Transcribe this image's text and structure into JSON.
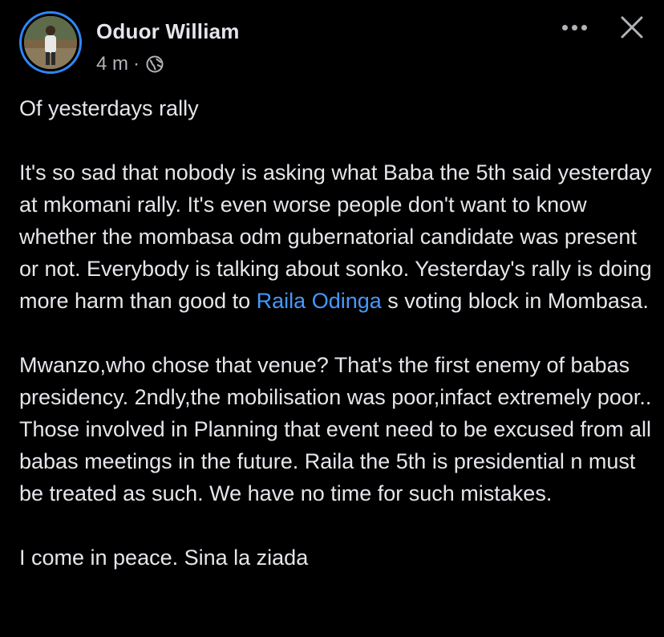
{
  "post": {
    "author": {
      "name": "Oduor William",
      "timestamp": "4 m",
      "separator": "·",
      "privacy_icon": "globe-icon"
    },
    "actions": {
      "more_icon": "more-horizontal-icon",
      "close_icon": "close-icon"
    },
    "body": {
      "title_line": "Of yesterdays rally",
      "paragraph_1_before": "It's so sad that nobody is asking what Baba the 5th said yesterday at mkomani rally. It's even worse people don't want to know whether the mombasa odm gubernatorial candidate was present or not. Everybody is talking about sonko. Yesterday's rally is doing more harm than good to ",
      "mention": "Raila Odinga",
      "paragraph_1_after": " s voting block in Mombasa.",
      "paragraph_2": "Mwanzo,who chose that venue? That's the first enemy of babas presidency. 2ndly,the mobilisation was poor,infact extremely poor.. Those involved in Planning that event need to be excused from all babas meetings in the future. Raila the 5th is presidential n must be treated as such. We have no time for such mistakes.",
      "closing_line": "I come in peace. Sina la ziada"
    }
  },
  "colors": {
    "background": "#000000",
    "text_primary": "#e4e6eb",
    "text_secondary": "#b0b3b8",
    "link": "#4599ff",
    "avatar_ring": "#2d88ff"
  }
}
